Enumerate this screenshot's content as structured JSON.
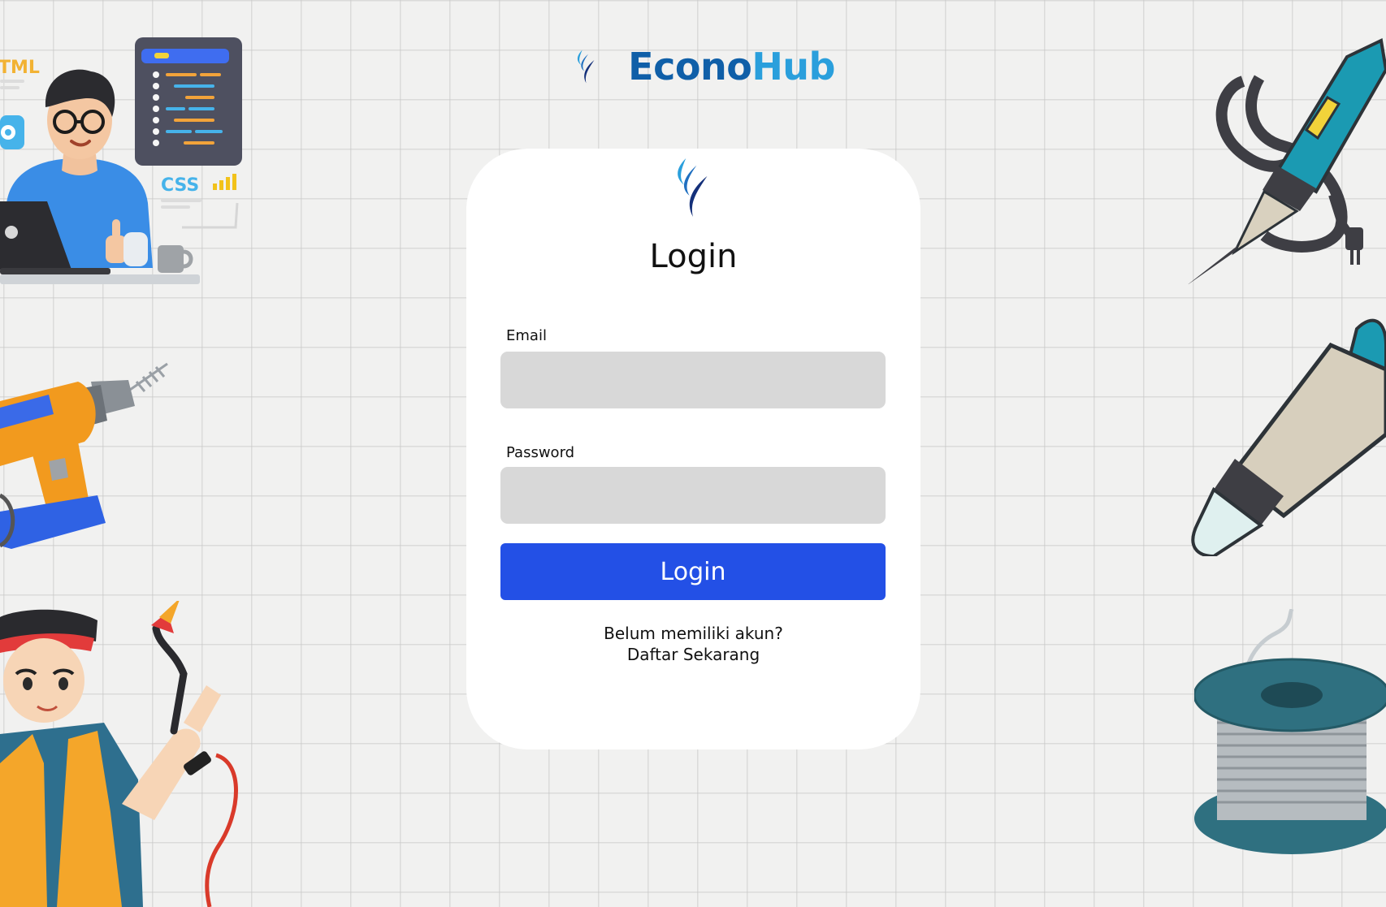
{
  "brand": {
    "name_part1": "Econo",
    "name_part2": "Hub"
  },
  "login_card": {
    "title": "Login",
    "email": {
      "label": "Email",
      "value": "",
      "placeholder": ""
    },
    "password": {
      "label": "Password",
      "value": "",
      "placeholder": ""
    },
    "submit_label": "Login",
    "signup_prompt": "Belum memiliki akun?",
    "signup_link": "Daftar Sekarang"
  },
  "decor": {
    "developer_html_label": "TML",
    "developer_css_label": "CSS"
  },
  "colors": {
    "brand_dark": "#0f5fa8",
    "brand_light": "#2a9fdc",
    "button": "#2350e6",
    "input_bg": "#d8d8d8"
  }
}
